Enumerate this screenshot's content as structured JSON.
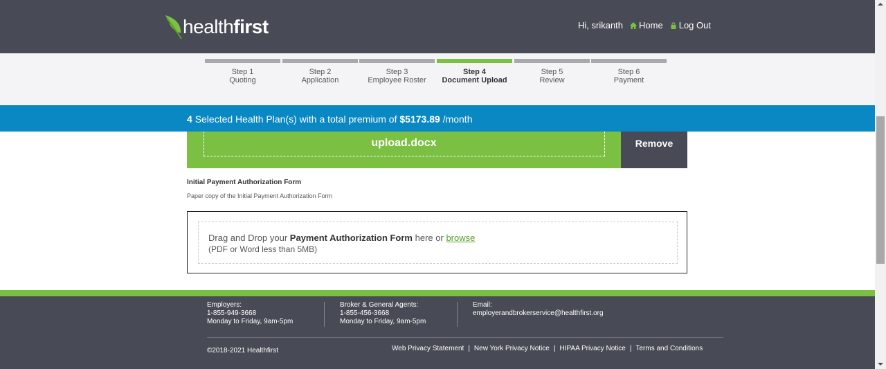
{
  "brand": {
    "logo_light": "health",
    "logo_bold": "first",
    "accent": "#7bc043",
    "header_bg": "#484b55",
    "blue": "#0a88c3"
  },
  "user_nav": {
    "greeting": "Hi, srikanth",
    "home": "Home",
    "logout": "Log Out"
  },
  "steps": [
    {
      "num": "Step 1",
      "name": "Quoting",
      "active": false
    },
    {
      "num": "Step 2",
      "name": "Application",
      "active": false
    },
    {
      "num": "Step 3",
      "name": "Employee Roster",
      "active": false
    },
    {
      "num": "Step 4",
      "name": "Document Upload",
      "active": true
    },
    {
      "num": "Step 5",
      "name": "Review",
      "active": false
    },
    {
      "num": "Step 6",
      "name": "Payment",
      "active": false
    }
  ],
  "summary": {
    "count": "4",
    "text_mid": "Selected Health Plan(s) with a total premium of",
    "amount": "$5173.89",
    "per": "/month"
  },
  "uploaded": {
    "filename": "upload.docx",
    "remove": "Remove"
  },
  "payment_form": {
    "title": "Initial Payment Authorization Form",
    "description": "Paper copy of the Initial Payment Authorization Form",
    "drop_prefix": "Drag and Drop your",
    "drop_doc": "Payment Authorization Form",
    "drop_mid": "here or",
    "browse": "browse",
    "limits": "(PDF or Word less than 5MB)"
  },
  "footer": {
    "employers": {
      "label": "Employers:",
      "phone": "1-855-949-3668",
      "hours": "Monday to Friday, 9am-5pm"
    },
    "brokers": {
      "label": "Broker & General Agents:",
      "phone": "1-855-456-3668",
      "hours": "Monday to Friday, 9am-5pm"
    },
    "email": {
      "label": "Email:",
      "address": "employerandbrokerservice@healthfirst.org"
    },
    "copyright": "©2018-2021 Healthfirst",
    "links": [
      "Web Privacy Statement",
      "New York Privacy Notice",
      "HIPAA Privacy Notice",
      "Terms and Conditions"
    ]
  }
}
